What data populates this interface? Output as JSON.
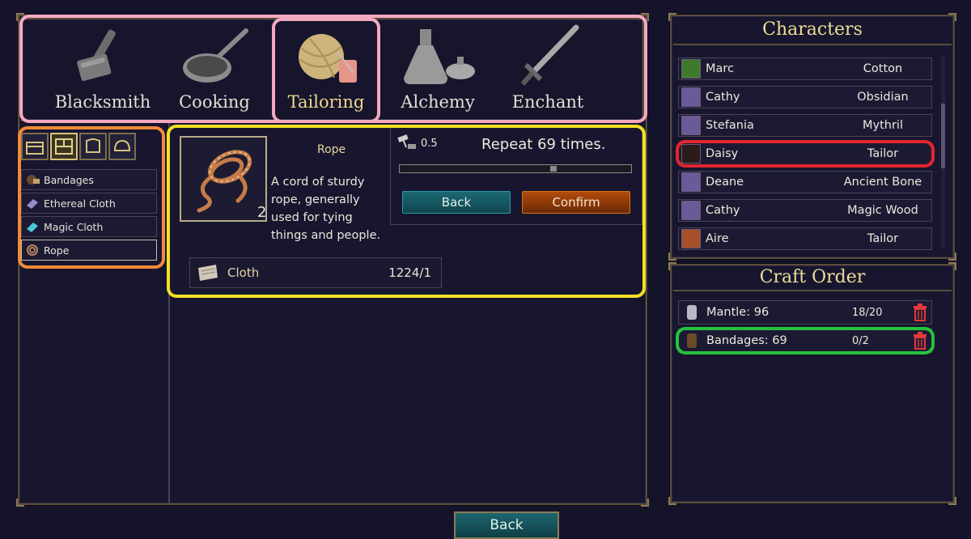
{
  "categories": [
    {
      "label": "Blacksmith",
      "icon": "hammer-icon"
    },
    {
      "label": "Cooking",
      "icon": "frying-pan-icon"
    },
    {
      "label": "Tailoring",
      "icon": "yarn-ball-icon",
      "active": true
    },
    {
      "label": "Alchemy",
      "icon": "flask-icon"
    },
    {
      "label": "Enchant",
      "icon": "sword-icon"
    }
  ],
  "subtabs": [
    {
      "icon": "chest-icon"
    },
    {
      "icon": "layout-icon",
      "active": true
    },
    {
      "icon": "armor-icon"
    },
    {
      "icon": "helmet-icon"
    }
  ],
  "recipes": [
    {
      "label": "Bandages",
      "icon": "bandage-icon"
    },
    {
      "label": "Ethereal Cloth",
      "icon": "cloth-icon"
    },
    {
      "label": "Magic Cloth",
      "icon": "magic-cloth-icon"
    },
    {
      "label": "Rope",
      "icon": "rope-icon",
      "selected": true
    }
  ],
  "detail": {
    "name": "Rope",
    "quantity": "2",
    "description": "A cord of sturdy rope, generally used for tying things and people.",
    "craft_time": "0.5",
    "repeat_text": "Repeat 69 times.",
    "progress": 0.67,
    "back_label": "Back",
    "confirm_label": "Confirm",
    "material": {
      "name": "Cloth",
      "count": "1224/1"
    }
  },
  "characters": {
    "title": "Characters",
    "list": [
      {
        "name": "Marc",
        "job": "Cotton",
        "avatar_color": "#3f7a2c"
      },
      {
        "name": "Cathy",
        "job": "Obsidian",
        "avatar_color": "#6a5a9a"
      },
      {
        "name": "Stefania",
        "job": "Mythril",
        "avatar_color": "#6a5a9a"
      },
      {
        "name": "Daisy",
        "job": "Tailor",
        "avatar_color": "#2a1a1a"
      },
      {
        "name": "Deane",
        "job": "Ancient Bone",
        "avatar_color": "#6a5a9a"
      },
      {
        "name": "Cathy",
        "job": "Magic Wood",
        "avatar_color": "#6a5a9a"
      },
      {
        "name": "Aire",
        "job": "Tailor",
        "avatar_color": "#a6502a"
      }
    ]
  },
  "craft_order": {
    "title": "Craft Order",
    "list": [
      {
        "name": "Mantle: 96",
        "progress": "18/20",
        "icon": "mantle-icon"
      },
      {
        "name": "Bandages: 69",
        "progress": "0/2",
        "icon": "bandage-icon"
      }
    ]
  },
  "bottom_back_label": "Back"
}
